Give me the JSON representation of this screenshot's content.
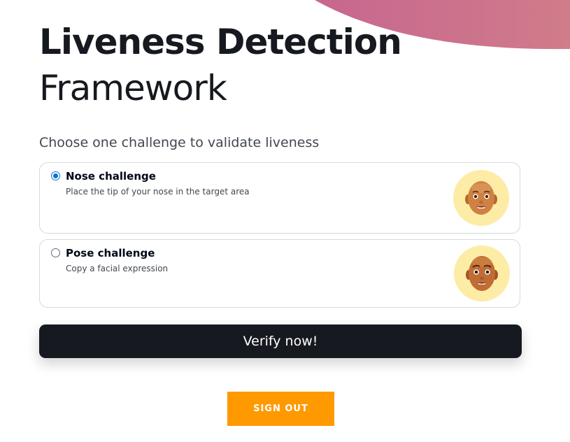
{
  "header": {
    "title": "Liveness Detection",
    "subtitle": "Framework"
  },
  "challenge_select": {
    "prompt": "Choose one challenge to validate liveness",
    "options": [
      {
        "title": "Nose challenge",
        "description": "Place the tip of your nose in the target area",
        "selected": true,
        "icon": "face-avatar-icon"
      },
      {
        "title": "Pose challenge",
        "description": "Copy a facial expression",
        "selected": false,
        "icon": "face-avatar-icon"
      }
    ]
  },
  "actions": {
    "verify_label": "Verify now!",
    "signout_label": "SIGN OUT"
  },
  "colors": {
    "accent_blob_start": "#c7668f",
    "accent_blob_end": "#d07c8a",
    "verify_button": "#16191f",
    "signout_button": "#ff9900",
    "radio_selected": "#0972d3"
  }
}
